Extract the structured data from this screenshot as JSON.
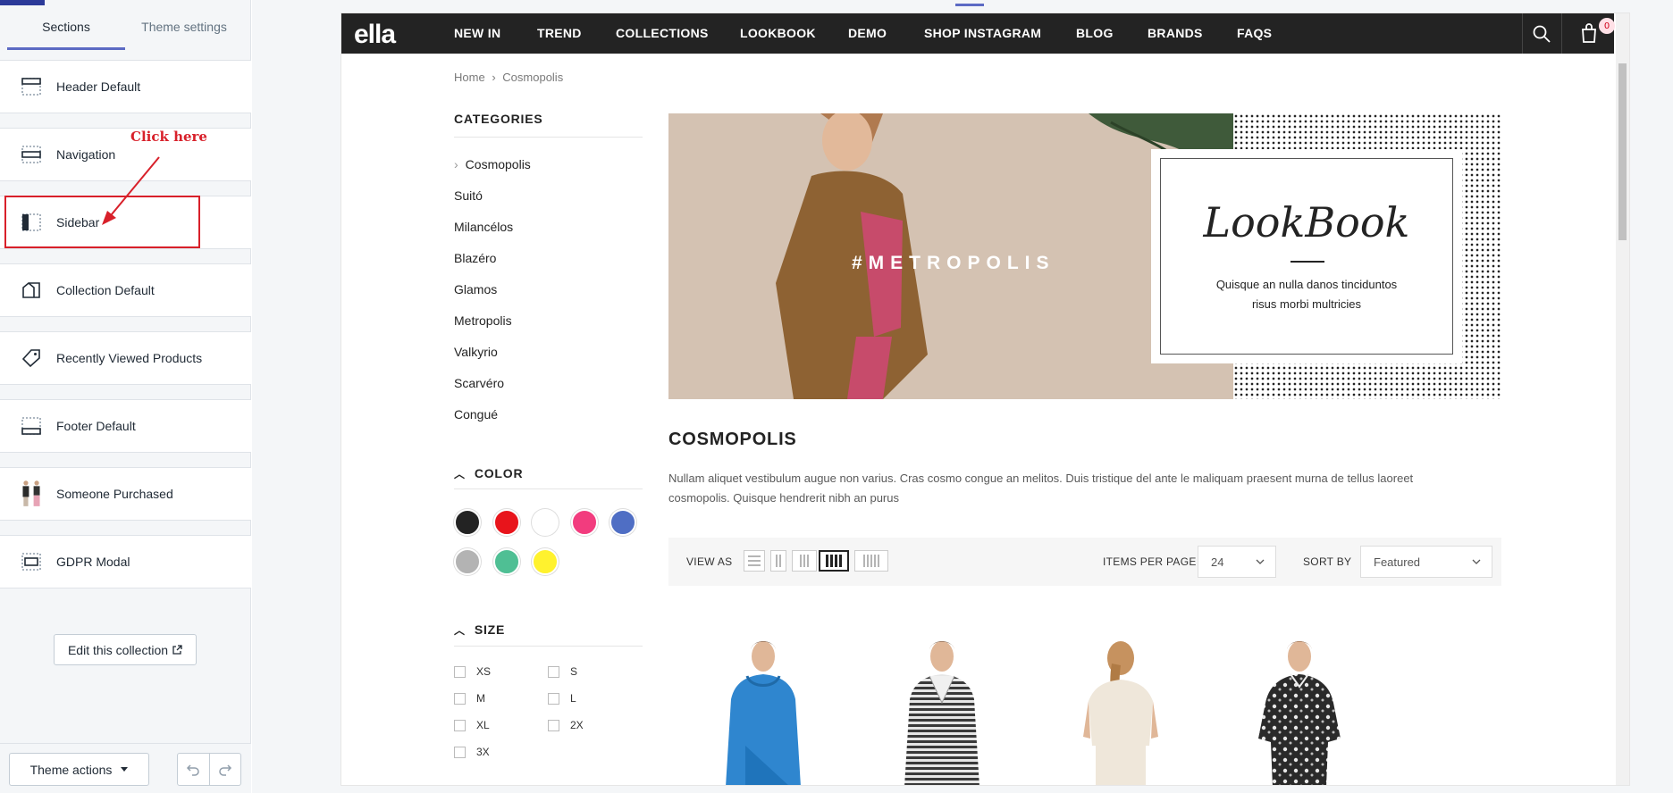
{
  "panel": {
    "tabs": [
      "Sections",
      "Theme settings"
    ],
    "sections": [
      {
        "label": "Header Default",
        "icon": "header-icon"
      },
      {
        "label": "Navigation",
        "icon": "navigation-icon"
      },
      {
        "label": "Sidebar",
        "icon": "sidebar-icon"
      },
      {
        "label": "Collection Default",
        "icon": "collection-icon"
      },
      {
        "label": "Recently Viewed Products",
        "icon": "tag-icon"
      },
      {
        "label": "Footer Default",
        "icon": "footer-icon"
      },
      {
        "label": "Someone Purchased",
        "icon": "product-thumbnails-icon"
      },
      {
        "label": "GDPR Modal",
        "icon": "modal-icon"
      }
    ],
    "annotation": "Click here",
    "edit_collection": "Edit this collection",
    "theme_actions": "Theme actions",
    "accent": "#5c6ac4",
    "highlight_color": "#d8202a"
  },
  "store": {
    "logo": "ella",
    "nav": [
      "NEW IN",
      "TREND",
      "COLLECTIONS",
      "LOOKBOOK",
      "DEMO",
      "SHOP INSTAGRAM",
      "BLOG",
      "BRANDS",
      "FAQS"
    ],
    "cart_count": "0",
    "breadcrumb": {
      "home": "Home",
      "current": "Cosmopolis"
    },
    "sidebar": {
      "categories_title": "CATEGORIES",
      "categories": [
        "Cosmopolis",
        "Suitó",
        "Milancélos",
        "Blazéro",
        "Glamos",
        "Metropolis",
        "Valkyrio",
        "Scarvéro",
        "Congué"
      ],
      "color_title": "COLOR",
      "colors": [
        "#232323",
        "#e8141b",
        "#ffffff",
        "#f23c7e",
        "#4f6ec4",
        "#b3b3b3",
        "#4fbf94",
        "#fff22e"
      ],
      "size_title": "SIZE",
      "sizes": [
        "XS",
        "S",
        "M",
        "L",
        "XL",
        "2X",
        "3X"
      ]
    },
    "banner": {
      "hashtag": "#METROPOLIS",
      "title": "LookBook",
      "text_line1": "Quisque an nulla danos tinciduntos",
      "text_line2": "risus morbi multricies"
    },
    "collection": {
      "title": "COSMOPOLIS",
      "description": "Nullam aliquet vestibulum augue non varius. Cras cosmo congue an melitos. Duis tristique del ante le maliquam praesent murna de tellus laoreet cosmopolis. Quisque hendrerit nibh an purus"
    },
    "toolbar": {
      "view_as": "VIEW AS",
      "items_per_page_label": "ITEMS PER PAGE",
      "items_per_page": "24",
      "sort_by_label": "SORT BY",
      "sort_by": "Featured"
    },
    "products": [
      {
        "name": "blue-hoodie",
        "color": "#2f86cf"
      },
      {
        "name": "striped-hoodie",
        "color": "#cfcfcf"
      },
      {
        "name": "cream-top",
        "color": "#efe7da"
      },
      {
        "name": "paisley-shirt",
        "color": "#2a2a2a"
      }
    ]
  }
}
